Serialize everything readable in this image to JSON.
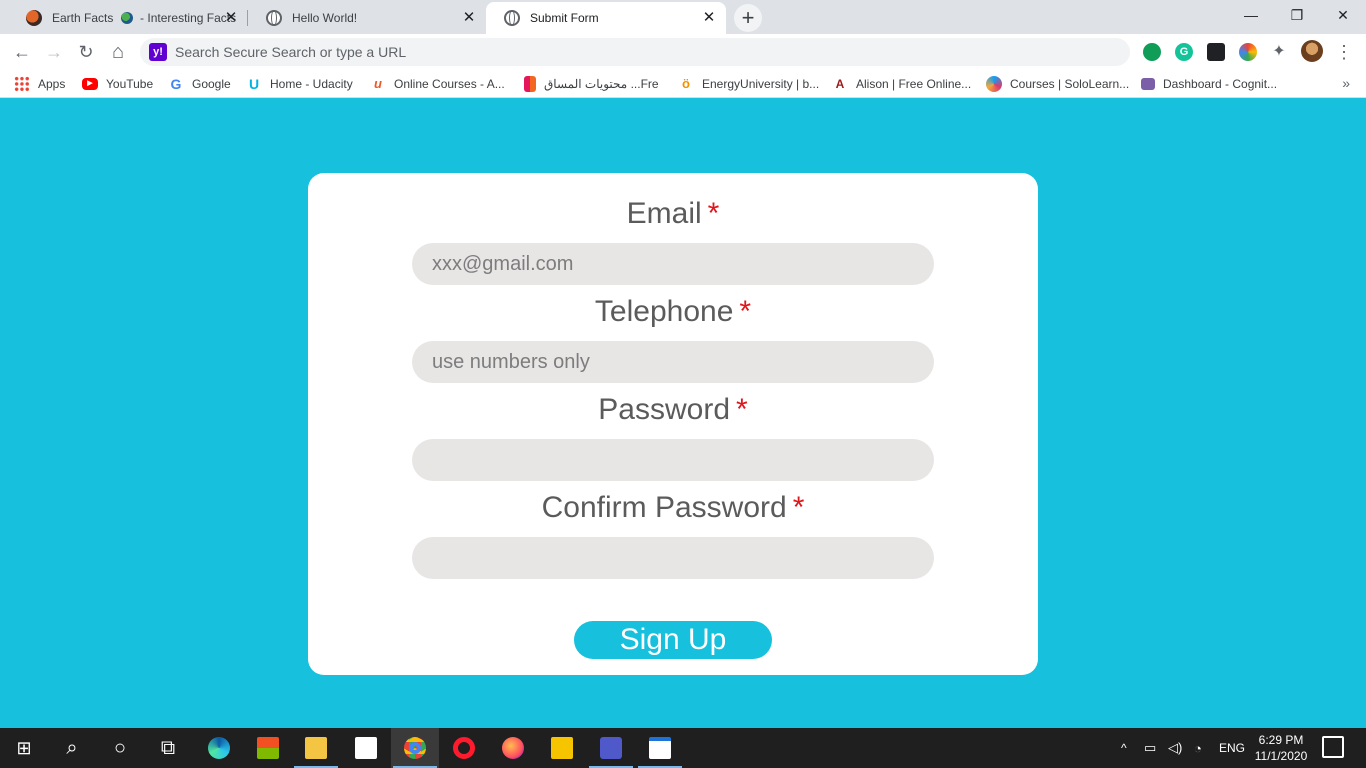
{
  "browser": {
    "tabs": [
      {
        "title": "Earth Facts",
        "title_suffix": "- Interesting Facts",
        "close": "✕"
      },
      {
        "title": "Hello World!",
        "close": "✕"
      },
      {
        "title": "Submit Form",
        "close": "✕"
      }
    ],
    "new_tab": "+",
    "window": {
      "minimize": "—",
      "maximize": "❐",
      "close": "✕"
    },
    "nav": {
      "back": "←",
      "forward": "→",
      "reload": "↻",
      "home": "⌂"
    },
    "search_engine_badge": "y!",
    "address_placeholder": "Search Secure Search or type a URL",
    "extensions": {
      "grammarly": "G",
      "puzzle": "✦"
    },
    "menu": "⋮"
  },
  "bookmarks": [
    {
      "label": "Apps",
      "icon": "apps-grid-icon"
    },
    {
      "label": "YouTube",
      "icon": "youtube-icon"
    },
    {
      "label": "Google",
      "icon": "google-icon"
    },
    {
      "label": "Home - Udacity",
      "icon": "udacity-icon"
    },
    {
      "label": "Online Courses - A...",
      "icon": "coursera-icon"
    },
    {
      "label": "محتويات المساق ...Fre",
      "icon": "forward-icon"
    },
    {
      "label": "EnergyUniversity | b...",
      "icon": "energy-icon"
    },
    {
      "label": "Alison | Free Online...",
      "icon": "alison-icon"
    },
    {
      "label": "Courses | SoloLearn...",
      "icon": "sololearn-icon"
    },
    {
      "label": "Dashboard - Cognit...",
      "icon": "cognitive-icon"
    }
  ],
  "bookmarks_more": "»",
  "bookmark_glyphs": {
    "youtube": "▶",
    "google": "G",
    "udacity": "U",
    "alison": "A",
    "energy": "ö",
    "sololearn": ""
  },
  "form": {
    "email": {
      "label": "Email",
      "placeholder": "xxx@gmail.com"
    },
    "telephone": {
      "label": "Telephone",
      "placeholder": "use numbers only"
    },
    "password": {
      "label": "Password",
      "placeholder": ""
    },
    "confirm_password": {
      "label": "Confirm Password",
      "placeholder": ""
    },
    "required_mark": "*",
    "submit_label": "Sign Up"
  },
  "colors": {
    "page_background": "#17c0dd",
    "button": "#17c0dd",
    "required": "#e0161b",
    "field_background": "#e8e5e5"
  },
  "taskbar": {
    "start": "⊞",
    "search": "⌕",
    "cortana": "○",
    "task_view": "⧉",
    "tray_caret": "^",
    "language": "ENG",
    "time": "6:29 PM",
    "date": "11/1/2020"
  }
}
